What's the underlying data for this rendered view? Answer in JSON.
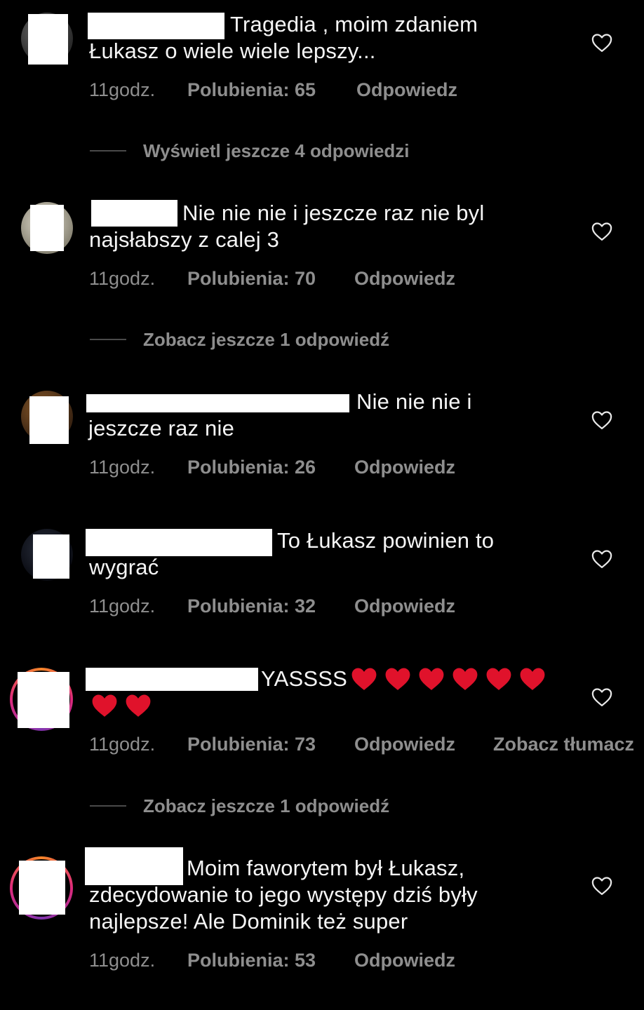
{
  "comments": [
    {
      "text_line1": "Tragedia , moim zdaniem",
      "text_line2": "Łukasz o wiele wiele lepszy...",
      "time": "11godz.",
      "likes": "Polubienia: 65",
      "reply": "Odpowiedz"
    },
    {
      "text_line1": "Nie nie nie i jeszcze raz nie byl",
      "text_line2": "najsłabszy z calej 3",
      "time": "11godz.",
      "likes": "Polubienia: 70",
      "reply": "Odpowiedz"
    },
    {
      "text_line1": "Nie nie nie i",
      "text_line2": "jeszcze raz nie",
      "time": "11godz.",
      "likes": "Polubienia: 26",
      "reply": "Odpowiedz"
    },
    {
      "text_line1": "To Łukasz powinien to",
      "text_line2": "wygrać",
      "time": "11godz.",
      "likes": "Polubienia: 32",
      "reply": "Odpowiedz"
    },
    {
      "text_line1": "YASSSS",
      "time": "11godz.",
      "likes": "Polubienia: 73",
      "reply": "Odpowiedz",
      "translate": "Zobacz tłumacz",
      "emoji_count": 8
    },
    {
      "text_line1": "Moim faworytem był Łukasz,",
      "text_line2": "zdecydowanie to jego występy dziś były",
      "text_line3": "najlepsze! Ale Dominik też super",
      "time": "11godz.",
      "likes": "Polubienia: 53",
      "reply": "Odpowiedz"
    }
  ],
  "threads": [
    {
      "label": "Wyświetl jeszcze 4 odpowiedzi"
    },
    {
      "label": "Zobacz jeszcze 1 odpowiedź"
    },
    {
      "label": "Zobacz jeszcze 1 odpowiedź"
    }
  ],
  "colors": {
    "background": "#000000",
    "text": "#f5f5f5",
    "meta": "#8e8e8e",
    "emoji_heart": "#e0122b"
  },
  "icons": {
    "like": "heart-outline-icon",
    "emoji": "red-heart-emoji"
  }
}
